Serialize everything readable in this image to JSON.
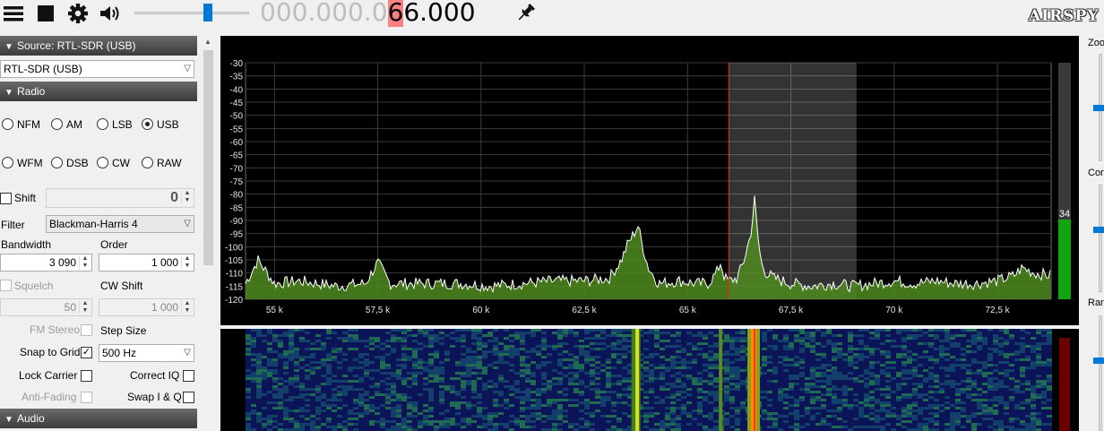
{
  "toolbar": {
    "icons": [
      "hamburger-menu-icon",
      "stop-icon",
      "gear-icon",
      "speaker-icon"
    ],
    "frequency": {
      "dim": "000.000.0",
      "hot": "6",
      "active": "6.000"
    },
    "logo": "AIRSPY",
    "colors": {
      "slider": "#0078d7",
      "freq_highlight": "#ff8080"
    }
  },
  "source": {
    "header": "Source: RTL-SDR (USB)",
    "device": "RTL-SDR (USB)"
  },
  "radio": {
    "header": "Radio",
    "modes_row1": [
      "NFM",
      "AM",
      "LSB",
      "USB"
    ],
    "modes_row2": [
      "WFM",
      "DSB",
      "CW",
      "RAW"
    ],
    "selected_mode": "USB",
    "shift_label": "Shift",
    "shift_value": "0",
    "filter_label": "Filter",
    "filter_value": "Blackman-Harris 4",
    "bandwidth_label": "Bandwidth",
    "bandwidth_value": "3 090",
    "order_label": "Order",
    "order_value": "1 000",
    "squelch_label": "Squelch",
    "squelch_value": "50",
    "cwshift_label": "CW Shift",
    "cwshift_value": "1 000",
    "fmstereo_label": "FM Stereo",
    "stepsize_label": "Step Size",
    "snap_label": "Snap to Grid",
    "snap_checked": "✓",
    "step_value": "500 Hz",
    "lockcarrier_label": "Lock Carrier",
    "correctiq_label": "Correct IQ",
    "antifading_label": "Anti-Fading",
    "swapiq_label": "Swap I & Q"
  },
  "audio": {
    "header": "Audio"
  },
  "right_panel": {
    "zoom_label": "Zoo",
    "contrast_label": "Cont",
    "range_label": "Ran"
  },
  "chart_data": {
    "type": "line",
    "title": "",
    "xlabel": "",
    "ylabel": "",
    "x_ticks": [
      "55 k",
      "57,5 k",
      "60 k",
      "62,5 k",
      "65 k",
      "67,5 k",
      "70 k",
      "72,5 k"
    ],
    "x_tick_values": [
      55000,
      57500,
      60000,
      62500,
      65000,
      67500,
      70000,
      72500
    ],
    "xlim": [
      54300,
      73800
    ],
    "y_ticks": [
      "-30",
      "-35",
      "-40",
      "-45",
      "-50",
      "-55",
      "-60",
      "-65",
      "-70",
      "-75",
      "-80",
      "-85",
      "-90",
      "-95",
      "-100",
      "-105",
      "-110",
      "-115",
      "-120"
    ],
    "ylim": [
      -120,
      -30
    ],
    "grid": true,
    "series": [
      {
        "x": [
          54300,
          54600,
          55000,
          55600,
          56500,
          57200,
          57500,
          57800,
          58500,
          59500,
          60200,
          61000,
          61800,
          62500,
          63100,
          63400,
          63550,
          63700,
          63800,
          63900,
          64050,
          64300,
          64800,
          65200,
          65500,
          65700,
          65800,
          65900,
          66000,
          66200,
          66350,
          66500,
          66550,
          66620,
          66700,
          66780,
          66900,
          67100,
          67500,
          68000,
          68500,
          69000,
          69500,
          70000,
          70500,
          71000,
          71500,
          72000,
          72500,
          72900,
          73100,
          73400,
          73800
        ],
        "y": [
          -114,
          -105,
          -114,
          -113,
          -115,
          -114,
          -106,
          -114,
          -114,
          -114,
          -115,
          -114,
          -113,
          -113,
          -112,
          -105,
          -99,
          -95,
          -92,
          -99,
          -108,
          -114,
          -113,
          -114,
          -114,
          -110,
          -106,
          -112,
          -113,
          -112,
          -106,
          -97,
          -93,
          -82,
          -96,
          -106,
          -110,
          -112,
          -114,
          -115,
          -114,
          -115,
          -114,
          -113,
          -114,
          -113,
          -114,
          -114,
          -113,
          -111,
          -108,
          -110,
          -111
        ]
      }
    ],
    "markers": {
      "tuned_frequency": 66000,
      "passband": [
        66000,
        69090
      ]
    },
    "level_meter": {
      "value": "34"
    }
  },
  "waterfall": {
    "colors": {
      "background": "#0a1456",
      "noise": "#12406a",
      "signal": "#d8e020",
      "strong": "#ff9000"
    }
  }
}
